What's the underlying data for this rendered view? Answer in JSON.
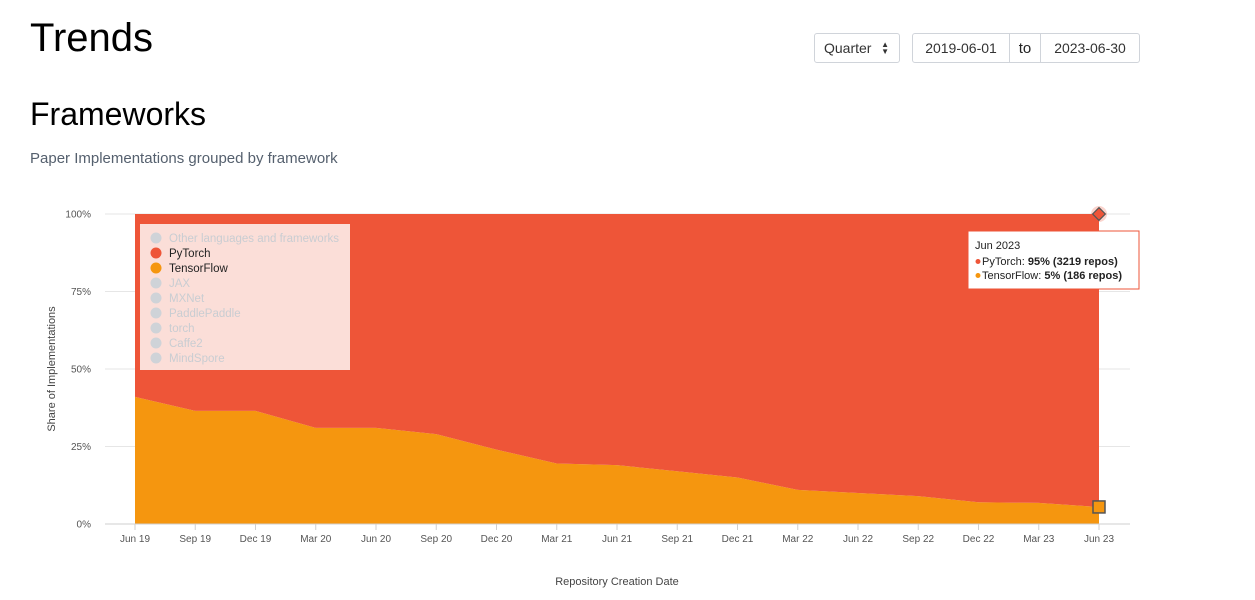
{
  "header": {
    "title": "Trends"
  },
  "controls": {
    "period": "Quarter",
    "date_from": "2019-06-01",
    "date_sep": "to",
    "date_to": "2023-06-30"
  },
  "section": {
    "title": "Frameworks",
    "subtitle": "Paper Implementations grouped by framework"
  },
  "colors": {
    "pytorch": "#ee5538",
    "tensorflow": "#f5960f",
    "disabled": "#cfd3d8",
    "legend_bg": "#fbded8"
  },
  "tooltip": {
    "title": "Jun 2023",
    "lines": [
      {
        "label": "PyTorch: ",
        "value": "95% (3219 repos)",
        "series": "pytorch"
      },
      {
        "label": "TensorFlow: ",
        "value": "5% (186 repos)",
        "series": "tensorflow"
      }
    ]
  },
  "chart_data": {
    "type": "area",
    "stacked": true,
    "normalized": true,
    "xlabel": "Repository Creation Date",
    "ylabel": "Share of Implementations",
    "categories": [
      "Jun 19",
      "Sep 19",
      "Dec 19",
      "Mar 20",
      "Jun 20",
      "Sep 20",
      "Dec 20",
      "Mar 21",
      "Jun 21",
      "Sep 21",
      "Dec 21",
      "Mar 22",
      "Jun 22",
      "Sep 22",
      "Dec 22",
      "Mar 23",
      "Jun 23"
    ],
    "yticks": [
      "0%",
      "25%",
      "50%",
      "75%",
      "100%"
    ],
    "ylim": [
      0,
      100
    ],
    "grid": true,
    "legend_position": "top-left",
    "legend": [
      {
        "name": "Other languages and frameworks",
        "active": false
      },
      {
        "name": "PyTorch",
        "active": true,
        "series": "pytorch"
      },
      {
        "name": "TensorFlow",
        "active": true,
        "series": "tensorflow"
      },
      {
        "name": "JAX",
        "active": false
      },
      {
        "name": "MXNet",
        "active": false
      },
      {
        "name": "PaddlePaddle",
        "active": false
      },
      {
        "name": "torch",
        "active": false
      },
      {
        "name": "Caffe2",
        "active": false
      },
      {
        "name": "MindSpore",
        "active": false
      }
    ],
    "series": [
      {
        "name": "TensorFlow",
        "key": "tensorflow",
        "values": [
          41,
          36.5,
          36.5,
          31,
          31,
          29,
          24,
          19.5,
          19,
          17,
          15,
          11,
          10,
          9,
          7,
          6.8,
          5.5
        ]
      },
      {
        "name": "PyTorch",
        "key": "pytorch",
        "values": [
          59,
          63.5,
          63.5,
          69,
          69,
          71,
          76,
          80.5,
          81,
          83,
          85,
          89,
          90,
          91,
          93,
          93.2,
          94.5
        ]
      }
    ]
  }
}
